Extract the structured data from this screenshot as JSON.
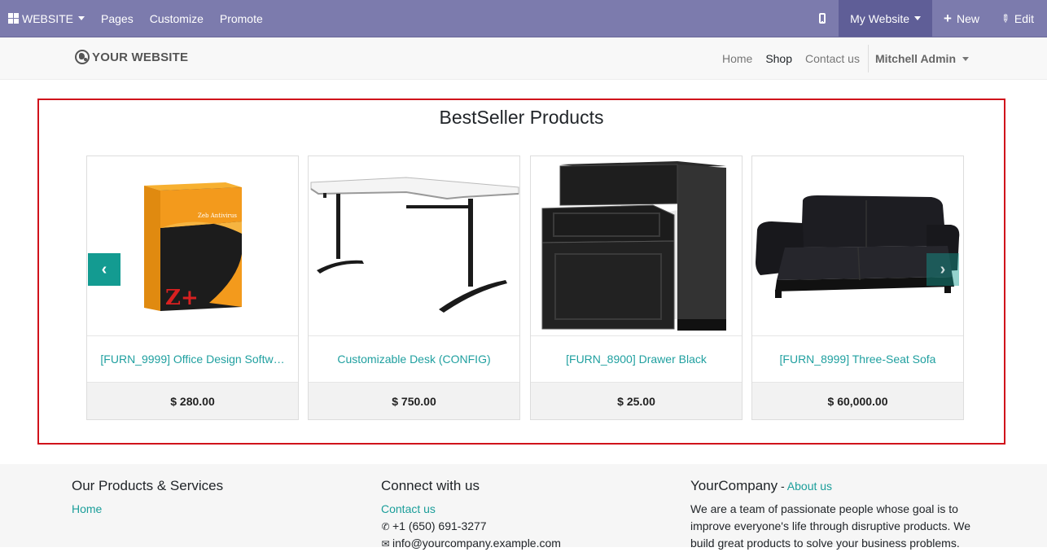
{
  "topbar": {
    "apps_label": "WEBSITE",
    "pages": "Pages",
    "customize": "Customize",
    "promote": "Promote",
    "site_selector": "My Website",
    "new": "New",
    "edit": "Edit",
    "bar_color": "#7c7bad"
  },
  "header": {
    "logo": "YOUR WEBSITE",
    "nav": [
      "Home",
      "Shop",
      "Contact us"
    ],
    "active_nav": "Shop",
    "user": "Mitchell Admin"
  },
  "snippet": {
    "title": "BestSeller Products",
    "products": [
      {
        "name": "[FURN_9999] Office Design Softw…",
        "price": "$ 280.00",
        "image": "software-box"
      },
      {
        "name": "Customizable Desk (CONFIG)",
        "price": "$ 750.00",
        "image": "desk"
      },
      {
        "name": "[FURN_8900] Drawer Black",
        "price": "$ 25.00",
        "image": "drawer-cabinet"
      },
      {
        "name": "[FURN_8999] Three-Seat Sofa",
        "price": "$ 60,000.00",
        "image": "sofa"
      }
    ],
    "box_text_top": "Zeb Antivirus",
    "box_text_bottom": "Z+",
    "prev": "‹",
    "next": "›",
    "accent": "#139b91",
    "highlight_border": "#d0121b"
  },
  "footer": {
    "col1": {
      "title": "Our Products & Services",
      "links": [
        "Home"
      ]
    },
    "col2": {
      "title": "Connect with us",
      "link": "Contact us",
      "phone": "+1 (650) 691-3277",
      "email": "info@yourcompany.example.com"
    },
    "col3": {
      "title": "YourCompany",
      "sep": " - ",
      "about": "About us",
      "text": "We are a team of passionate people whose goal is to improve everyone's life through disruptive products. We build great products to solve your business problems."
    }
  }
}
